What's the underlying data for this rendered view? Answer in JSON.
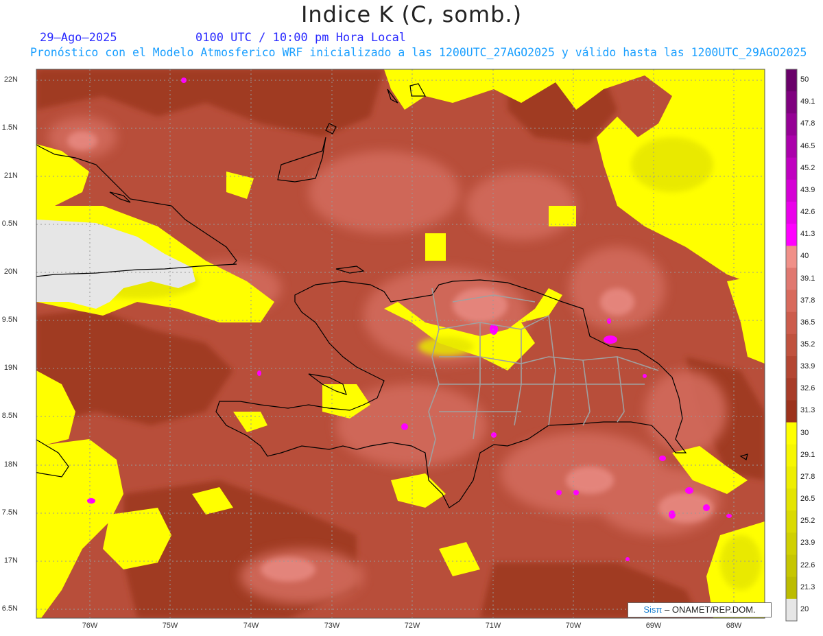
{
  "header": {
    "title": "Indice K (C, somb.)",
    "date": "29–Ago–2025",
    "time": "0100 UTC / 10:00 pm Hora Local",
    "description": "Pronóstico con el Modelo Atmosferico WRF inicializado a las 1200UTC_27AGO2025 y válido hasta las  1200UTC_29AGO2025"
  },
  "map": {
    "lat_labels": [
      "22N",
      "1.5N",
      "21N",
      "0.5N",
      "20N",
      "9.5N",
      "19N",
      "8.5N",
      "18N",
      "7.5N",
      "17N",
      "6.5N"
    ],
    "lon_labels": [
      "76W",
      "75W",
      "74W",
      "73W",
      "72W",
      "71W",
      "70W",
      "69W",
      "68W"
    ],
    "colors": {
      "dark_brown": "#a03a20",
      "mid_brown": "#b84e3a",
      "light_brown": "#d26a5c",
      "pink": "#e88a82",
      "magenta": "#ff00ff",
      "yellow": "#ffff00",
      "olive_yellow": "#e6e600",
      "gray_low": "#e6e6e6"
    }
  },
  "colorbar": {
    "labels": [
      "50",
      "49.1",
      "47.8",
      "46.5",
      "45.2",
      "43.9",
      "42.6",
      "41.3",
      "40",
      "39.1",
      "37.8",
      "36.5",
      "35.2",
      "33.9",
      "32.6",
      "31.3",
      "30",
      "29.1",
      "27.8",
      "26.5",
      "25.2",
      "23.9",
      "22.6",
      "21.3",
      "20"
    ],
    "colors": [
      "#6a006a",
      "#7f007f",
      "#950095",
      "#ab00ab",
      "#c000c0",
      "#d500d5",
      "#ea00ea",
      "#ff00ff",
      "#f09088",
      "#e07870",
      "#d86a5c",
      "#cc5c4c",
      "#c0523e",
      "#b44632",
      "#a83c28",
      "#9c321c",
      "#ffff00",
      "#f7f700",
      "#eeee00",
      "#e4e400",
      "#dada00",
      "#d0d000",
      "#c6c600",
      "#bcbc00",
      "#e6e6e6"
    ]
  },
  "credit": {
    "logo": "Sisπ",
    "text": "– ONAMET/REP.DOM."
  }
}
